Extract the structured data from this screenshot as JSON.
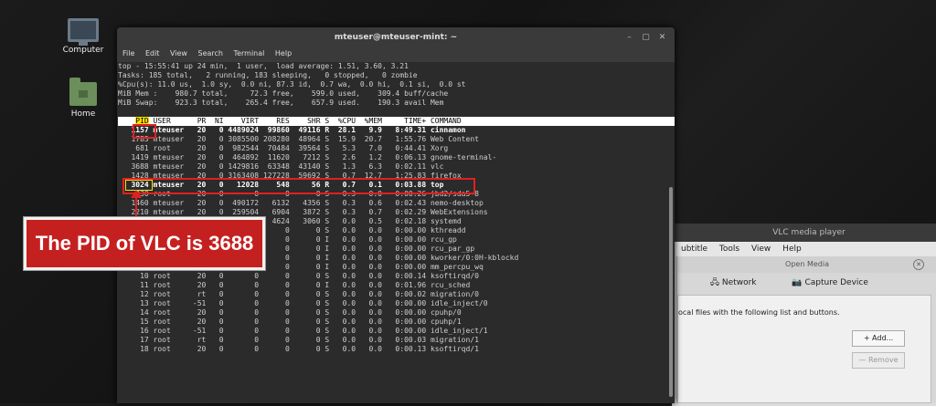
{
  "desktop": {
    "icons": [
      {
        "label": "Computer"
      },
      {
        "label": "Home"
      }
    ]
  },
  "terminal": {
    "title": "mteuser@mteuser-mint: ~",
    "menu": [
      "File",
      "Edit",
      "View",
      "Search",
      "Terminal",
      "Help"
    ],
    "summary": [
      "top - 15:55:41 up 24 min,  1 user,  load average: 1.51, 3.60, 3.21",
      "Tasks: 185 total,   2 running, 183 sleeping,   0 stopped,   0 zombie",
      "%Cpu(s): 11.0 us,  1.0 sy,  0.0 ni, 87.3 id,  0.7 wa,  0.0 hi,  0.1 si,  0.0 st",
      "MiB Mem :    980.7 total,     72.3 free,    599.0 used,    309.4 buff/cache",
      "MiB Swap:    923.3 total,    265.4 free,    657.9 used.    190.3 avail Mem"
    ],
    "header_pid": "PID",
    "header_rest": " USER      PR  NI    VIRT    RES    SHR S  %CPU  %MEM     TIME+ COMMAND",
    "processes": [
      "   1157 mteuser   20   0 4489024  99860  49116 R  28.1   9.9   8:49.31 cinnamon",
      "   1783 mteuser   20   0 3085500 208280  48964 S  15.9  20.7   1:55.76 Web Content",
      "    681 root      20   0  982544  70484  39564 S   5.3   7.0   0:44.41 Xorg",
      "   1419 mteuser   20   0  464892  11620   7212 S   2.6   1.2   0:06.13 gnome-terminal-",
      "   3688 mteuser   20   0 1429816  63348  43140 S   1.3   6.3   0:02.11 vlc",
      "   1428 mteuser   20   0 3163408 127228  59692 S   0.7  12.7   1:25.83 firefox",
      "   3024 mteuser   20   0   12028    548     56 R   0.7   0.1   0:03.88 top",
      "    330 root      20   0       0      0      0 S   0.3   0.0   0:00.26 jbd2/sda5-8",
      "   1460 mteuser   20   0  490172   6132   4356 S   0.3   0.6   0:02.43 nemo-desktop",
      "   2210 mteuser   20   0  259504   6904   3872 S   0.3   0.7   0:02.29 WebExtensions",
      "      1 root      20   0  102584   4624   3060 S   0.0   0.5   0:02.18 systemd",
      "      2 root      20   0       0      0      0 S   0.0   0.0   0:00.00 kthreadd",
      "      3 root       0 -20       0      0      0 I   0.0   0.0   0:00.00 rcu_gp",
      "      4 root       0 -20       0      0      0 I   0.0   0.0   0:00.00 rcu_par_gp",
      "      6 root       0 -20       0      0      0 I   0.0   0.0   0:00.00 kworker/0:0H-kblockd",
      "      9 root       0 -20       0      0      0 I   0.0   0.0   0:00.00 mm_percpu_wq",
      "     10 root      20   0       0      0      0 S   0.0   0.0   0:00.14 ksoftirqd/0",
      "     11 root      20   0       0      0      0 I   0.0   0.0   0:01.96 rcu_sched",
      "     12 root      rt   0       0      0      0 S   0.0   0.0   0:00.02 migration/0",
      "     13 root     -51   0       0      0      0 S   0.0   0.0   0:00.00 idle_inject/0",
      "     14 root      20   0       0      0      0 S   0.0   0.0   0:00.00 cpuhp/0",
      "     15 root      20   0       0      0      0 S   0.0   0.0   0:00.00 cpuhp/1",
      "     16 root     -51   0       0      0      0 S   0.0   0.0   0:00.00 idle_inject/1",
      "     17 root      rt   0       0      0      0 S   0.0   0.0   0:00.03 migration/1",
      "     18 root      20   0       0      0      0 S   0.0   0.0   0:00.13 ksoftirqd/1"
    ]
  },
  "annotation": {
    "callout_text": "The PID of VLC is 3688",
    "highlight_color": "#e02020"
  },
  "vlc": {
    "title": "VLC media player",
    "menu": [
      "ubtitle",
      "Tools",
      "View",
      "Help"
    ]
  },
  "open_media": {
    "title": "Open Media",
    "tabs": [
      "Network",
      "Capture Device"
    ],
    "description": "ocal files with the following list and buttons.",
    "add_label": "+ Add...",
    "remove_label": "— Remove"
  }
}
